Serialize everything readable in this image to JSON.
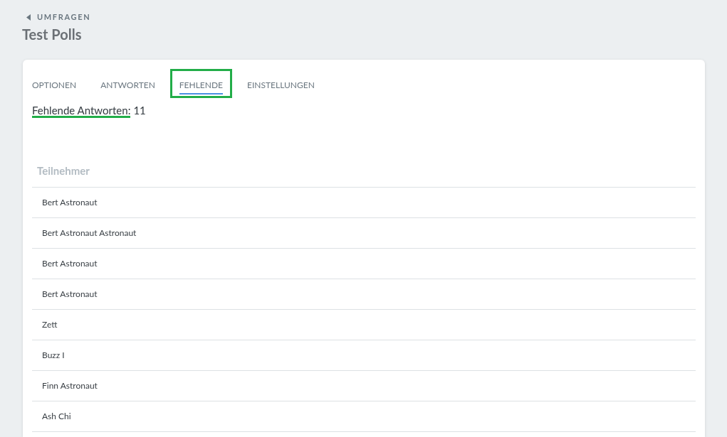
{
  "breadcrumb": {
    "label": "UMFRAGEN"
  },
  "title": "Test Polls",
  "tabs": [
    {
      "label": "OPTIONEN",
      "selected": false,
      "highlighted": false
    },
    {
      "label": "ANTWORTEN",
      "selected": false,
      "highlighted": false
    },
    {
      "label": "FEHLENDE",
      "selected": true,
      "highlighted": true
    },
    {
      "label": "EINSTELLUNGEN",
      "selected": false,
      "highlighted": false
    }
  ],
  "summary": {
    "label": "Fehlende Antworten:",
    "count": "11",
    "underlined": true
  },
  "table": {
    "columns": [
      "Teilnehmer"
    ],
    "rows": [
      "Bert Astronaut",
      "Bert Astronaut Astronaut",
      "Bert Astronaut",
      "Bert Astronaut",
      "Zett",
      "Buzz I",
      "Finn Astronaut",
      "Ash Chi"
    ]
  }
}
